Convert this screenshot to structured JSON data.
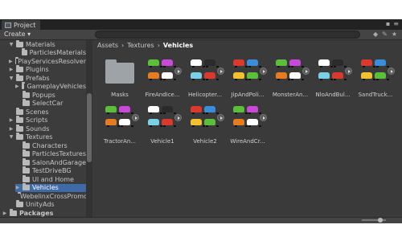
{
  "tab": {
    "title": "Project"
  },
  "toolbar": {
    "create_label": "Create ▾"
  },
  "tree": {
    "items": [
      {
        "label": "Materials",
        "depth": 1,
        "arrow": "▼",
        "selected": false
      },
      {
        "label": "ParticlesMaterials",
        "depth": 2,
        "arrow": "",
        "selected": false
      },
      {
        "label": "PlayServicesResolver",
        "depth": 1,
        "arrow": "▶",
        "selected": false
      },
      {
        "label": "Plugins",
        "depth": 1,
        "arrow": "▶",
        "selected": false
      },
      {
        "label": "Prefabs",
        "depth": 1,
        "arrow": "▼",
        "selected": false
      },
      {
        "label": "GameplayVehicles",
        "depth": 2,
        "arrow": "▶",
        "selected": false
      },
      {
        "label": "Popups",
        "depth": 2,
        "arrow": "",
        "selected": false
      },
      {
        "label": "SelectCar",
        "depth": 2,
        "arrow": "",
        "selected": false
      },
      {
        "label": "Scenes",
        "depth": 1,
        "arrow": "",
        "selected": false
      },
      {
        "label": "Scripts",
        "depth": 1,
        "arrow": "▶",
        "selected": false
      },
      {
        "label": "Sounds",
        "depth": 1,
        "arrow": "▶",
        "selected": false
      },
      {
        "label": "Textures",
        "depth": 1,
        "arrow": "▼",
        "selected": false
      },
      {
        "label": "Characters",
        "depth": 2,
        "arrow": "",
        "selected": false
      },
      {
        "label": "ParticlesTextures",
        "depth": 2,
        "arrow": "",
        "selected": false
      },
      {
        "label": "SalonAndGarage",
        "depth": 2,
        "arrow": "",
        "selected": false
      },
      {
        "label": "TestDriveBG",
        "depth": 2,
        "arrow": "",
        "selected": false
      },
      {
        "label": "UI and Home",
        "depth": 2,
        "arrow": "",
        "selected": false
      },
      {
        "label": "Vehicles",
        "depth": 2,
        "arrow": "▶",
        "selected": true
      },
      {
        "label": "WebelinxCrossPromotion",
        "depth": 2,
        "arrow": "",
        "selected": false
      },
      {
        "label": "UnityAds",
        "depth": 1,
        "arrow": "",
        "selected": false
      },
      {
        "label": "Packages",
        "depth": 0,
        "arrow": "▶",
        "selected": false
      }
    ]
  },
  "breadcrumb": {
    "parts": [
      "Assets",
      "Textures",
      "Vehicles"
    ],
    "separator": "›"
  },
  "assets": [
    {
      "label": "Masks",
      "kind": "folder"
    },
    {
      "label": "FireAndIce...",
      "kind": "sheet"
    },
    {
      "label": "Helicopter...",
      "kind": "sheet"
    },
    {
      "label": "JipAndPoli...",
      "kind": "sheet"
    },
    {
      "label": "MonsterAn...",
      "kind": "sheet"
    },
    {
      "label": "NloAndBul...",
      "kind": "sheet"
    },
    {
      "label": "SandTruck...",
      "kind": "sheet"
    },
    {
      "label": "TractorAn...",
      "kind": "sheet"
    },
    {
      "label": "Vehicle1",
      "kind": "sheet"
    },
    {
      "label": "Vehicle2",
      "kind": "sheet"
    },
    {
      "label": "WireAndCr...",
      "kind": "sheet"
    }
  ],
  "colors": {
    "selection": "#3e6aa8",
    "panel": "#3c3c3c",
    "content": "#3a3a3a"
  }
}
